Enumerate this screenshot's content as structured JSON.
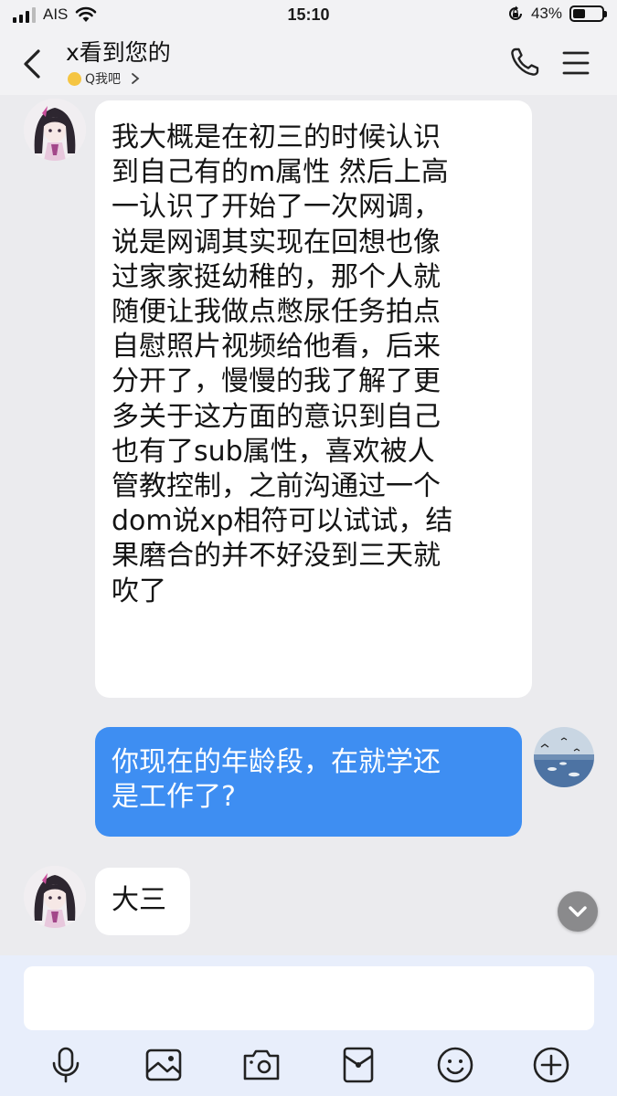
{
  "status_bar": {
    "carrier": "AIS",
    "time": "15:10",
    "battery_percent_label": "43%",
    "battery_level": 0.43
  },
  "header": {
    "title": "x看到您的",
    "subtitle": "Q我吧",
    "icons": [
      "chevron-left-icon",
      "phone-icon",
      "menu-icon"
    ]
  },
  "messages": [
    {
      "direction": "incoming",
      "lines": [
        "我大概是在初三的时候认识",
        "到自己有的m属性 然后上高",
        "一认识了开始了一次网调，",
        "说是网调其实现在回想也像",
        "过家家挺幼稚的，那个人就",
        "随便让我做点憋尿任务拍点",
        "自慰照片视频给他看，后来",
        "分开了，慢慢的我了解了更",
        "多关于这方面的意识到自己",
        "也有了sub属性，喜欢被人",
        "管教控制，之前沟通过一个",
        "dom说xp相符可以试试，结",
        "果磨合的并不好没到三天就",
        "吹了"
      ]
    },
    {
      "direction": "outgoing",
      "lines": [
        "你现在的年龄段，在就学还",
        "是工作了?"
      ]
    },
    {
      "direction": "incoming",
      "lines": [
        "大三"
      ]
    }
  ],
  "input": {
    "value": "",
    "placeholder": ""
  },
  "toolbar": [
    "microphone-icon",
    "image-icon",
    "camera-icon",
    "red-packet-icon",
    "emoji-icon",
    "plus-icon"
  ],
  "colors": {
    "outgoing_bubble": "#3e8ef2",
    "incoming_bubble": "#ffffff",
    "chat_background": "#ebebee",
    "input_zone": "#e8eefb"
  }
}
